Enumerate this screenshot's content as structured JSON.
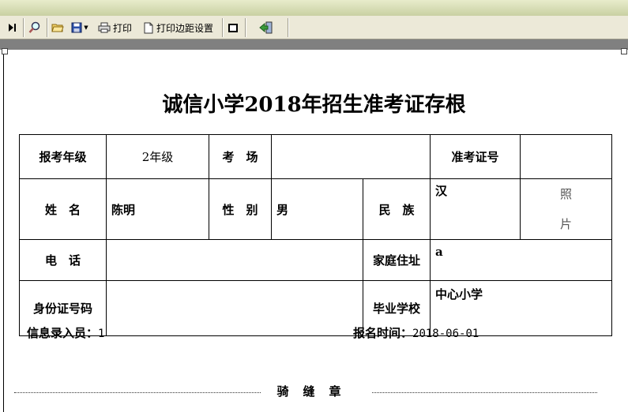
{
  "toolbar": {
    "print_label": "打印",
    "margin_label": "打印边距设置"
  },
  "form": {
    "title": "诚信小学2018年招生准考证存根",
    "grade_label": "报考年级",
    "grade_value": "2年级",
    "exam_room_label": "考　场",
    "exam_room_value": "",
    "ticket_no_label": "准考证号",
    "ticket_no_value": "",
    "photo_line1": "照",
    "photo_line2": "片",
    "name_label": "姓　名",
    "name_value": "陈明",
    "gender_label": "性　别",
    "gender_value": "男",
    "ethnicity_label": "民　族",
    "ethnicity_value": "汉",
    "phone_label": "电　话",
    "phone_value": "",
    "address_label": "家庭住址",
    "address_value": "a",
    "id_label": "身份证号码",
    "id_value": "",
    "school_label": "毕业学校",
    "school_value": "中心小学"
  },
  "footer": {
    "operator_label": "信息录入员：",
    "operator_value": "1",
    "date_label": "报名时间：",
    "date_value": "2018-06-01",
    "seal_text": "骑缝章"
  }
}
